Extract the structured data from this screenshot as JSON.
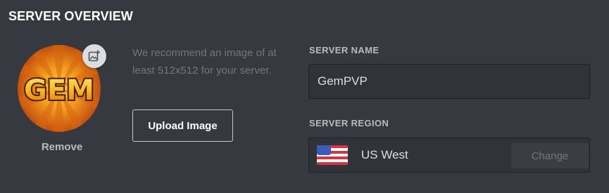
{
  "section": {
    "title": "SERVER OVERVIEW"
  },
  "avatar": {
    "logo_text": "GEM",
    "add_icon": "add-image-icon",
    "remove_label": "Remove"
  },
  "upload": {
    "hint": "We recommend an image of at least 512x512 for your server.",
    "button_label": "Upload Image"
  },
  "server_name": {
    "label": "SERVER NAME",
    "value": "GemPVP"
  },
  "server_region": {
    "label": "SERVER REGION",
    "flag_icon": "us-flag-icon",
    "value": "US West",
    "change_label": "Change"
  },
  "colors": {
    "background": "#36393f",
    "input_background": "#303339",
    "title": "#ffffff",
    "muted_text": "#72767d",
    "label_text": "#b9bbbe"
  }
}
